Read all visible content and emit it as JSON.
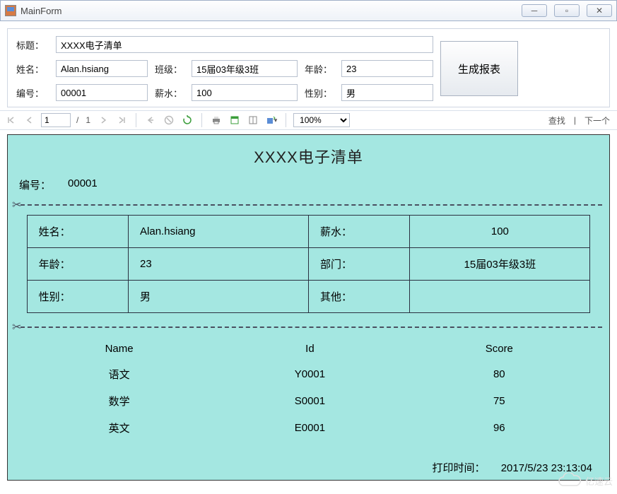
{
  "window": {
    "title": "MainForm"
  },
  "form": {
    "title_label": "标题：",
    "title_value": "XXXX电子清单",
    "name_label": "姓名：",
    "name_value": "Alan.hsiang",
    "class_label": "班级：",
    "class_value": "15届03年级3班",
    "age_label": "年龄：",
    "age_value": "23",
    "id_label": "编号：",
    "id_value": "00001",
    "salary_label": "薪水：",
    "salary_value": "100",
    "gender_label": "性别：",
    "gender_value": "男",
    "generate_button": "生成报表"
  },
  "toolbar": {
    "page_current": "1",
    "page_sep": "/",
    "page_total": "1",
    "zoom": "100%",
    "find": "查找",
    "next": "下一个"
  },
  "report": {
    "title": "XXXX电子清单",
    "id_label": "编号：",
    "id_value": "00001",
    "info": {
      "name_label": "姓名：",
      "name_value": "Alan.hsiang",
      "salary_label": "薪水：",
      "salary_value": "100",
      "age_label": "年龄：",
      "age_value": "23",
      "dept_label": "部门：",
      "dept_value": "15届03年级3班",
      "gender_label": "性别：",
      "gender_value": "男",
      "other_label": "其他：",
      "other_value": ""
    },
    "scores": {
      "headers": {
        "name": "Name",
        "id": "Id",
        "score": "Score"
      },
      "rows": [
        {
          "name": "语文",
          "id": "Y0001",
          "score": "80"
        },
        {
          "name": "数学",
          "id": "S0001",
          "score": "75"
        },
        {
          "name": "英文",
          "id": "E0001",
          "score": "96"
        }
      ]
    },
    "footer_label": "打印时间：",
    "footer_value": "2017/5/23 23:13:04"
  },
  "watermark": "亿速云"
}
